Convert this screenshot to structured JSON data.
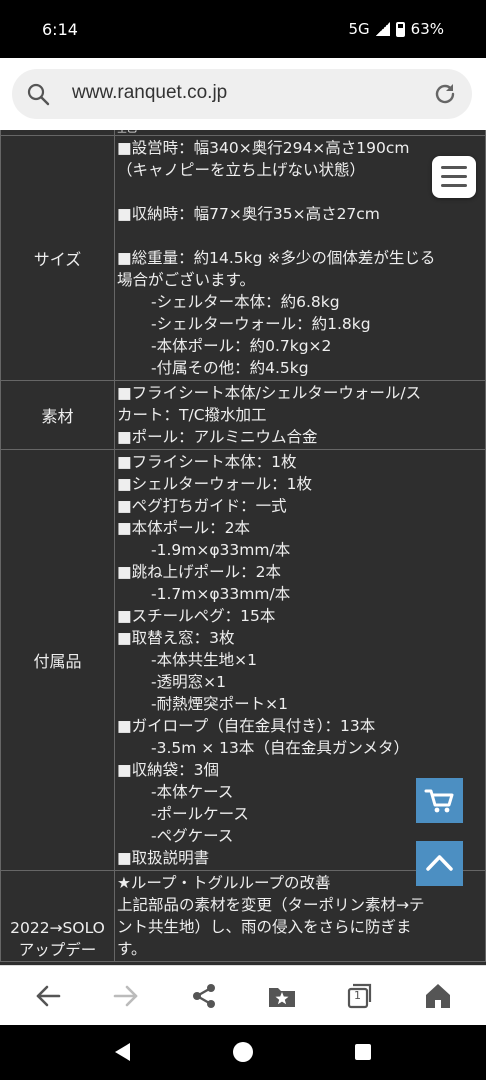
{
  "status_bar": {
    "time": "6:14",
    "network": "5G",
    "battery": "63%"
  },
  "browser": {
    "url": "www.ranquet.co.jp"
  },
  "table": {
    "partial_top_text": "全巴",
    "rows": [
      {
        "key": "サイズ",
        "lines": [
          {
            "text": "■設営時：幅340×奥行294×高さ190cm",
            "indent": false
          },
          {
            "text": "（キャノピーを立ち上げない状態）",
            "indent": false
          },
          {
            "text": "",
            "indent": false
          },
          {
            "text": "■収納時：幅77×奥行35×高さ27cm",
            "indent": false
          },
          {
            "text": "",
            "indent": false
          },
          {
            "text": "■総重量：約14.5kg ※多少の個体差が生じる",
            "indent": false
          },
          {
            "text": "場合がございます。",
            "indent": false
          },
          {
            "text": "-シェルター本体：約6.8kg",
            "indent": true
          },
          {
            "text": "-シェルターウォール：約1.8kg",
            "indent": true
          },
          {
            "text": "-本体ポール：約0.7kg×2",
            "indent": true
          },
          {
            "text": "-付属その他：約4.5kg",
            "indent": true
          }
        ]
      },
      {
        "key": "素材",
        "lines": [
          {
            "text": "■フライシート本体/シェルターウォール/ス",
            "indent": false
          },
          {
            "text": "カート：T/C撥水加工",
            "indent": false
          },
          {
            "text": "■ポール：アルミニウム合金",
            "indent": false
          }
        ]
      },
      {
        "key": "付属品",
        "lines": [
          {
            "text": "■フライシート本体：1枚",
            "indent": false
          },
          {
            "text": "■シェルターウォール：1枚",
            "indent": false
          },
          {
            "text": "■ペグ打ちガイド：一式",
            "indent": false
          },
          {
            "text": "■本体ポール：2本",
            "indent": false
          },
          {
            "text": "-1.9m×φ33mm/本",
            "indent": true
          },
          {
            "text": "■跳ね上げポール：2本",
            "indent": false
          },
          {
            "text": "-1.7m×φ33mm/本",
            "indent": true
          },
          {
            "text": "■スチールペグ：15本",
            "indent": false
          },
          {
            "text": "■取替え窓：3枚",
            "indent": false
          },
          {
            "text": "-本体共生地×1",
            "indent": true
          },
          {
            "text": "-透明窓×1",
            "indent": true
          },
          {
            "text": "-耐熱煙突ポート×1",
            "indent": true
          },
          {
            "text": "■ガイロープ（自在金具付き）：13本",
            "indent": false
          },
          {
            "text": "-3.5m × 13本（自在金具ガンメタ）",
            "indent": true
          },
          {
            "text": "■収納袋：3個",
            "indent": false
          },
          {
            "text": "-本体ケース",
            "indent": true
          },
          {
            "text": "-ポールケース",
            "indent": true
          },
          {
            "text": "-ペグケース",
            "indent": true
          },
          {
            "text": "■取扱説明書",
            "indent": false
          }
        ]
      },
      {
        "key_lines": [
          "2022→SOLO",
          "アップデー"
        ],
        "lines": [
          {
            "text": "★ループ・トグルループの改善",
            "indent": false
          },
          {
            "text": "上記部品の素材を変更（ターポリン素材→テ",
            "indent": false
          },
          {
            "text": "ント共生地）し、雨の侵入をさらに防ぎま",
            "indent": false
          },
          {
            "text": "す。",
            "indent": false
          }
        ]
      }
    ]
  },
  "icons": {
    "menu": "hamburger-icon",
    "cart": "cart-icon",
    "scroll_top": "chevron-up-icon",
    "back": "arrow-left-icon",
    "forward": "arrow-right-icon",
    "share": "share-icon",
    "bookmarks": "bookmark-star-icon",
    "tabs": "tabs-icon",
    "home": "home-icon"
  },
  "tabs_count": "1",
  "colors": {
    "page_bg": "#2e2e2e",
    "accent_button": "#4c8fc2",
    "table_border": "#666666"
  }
}
